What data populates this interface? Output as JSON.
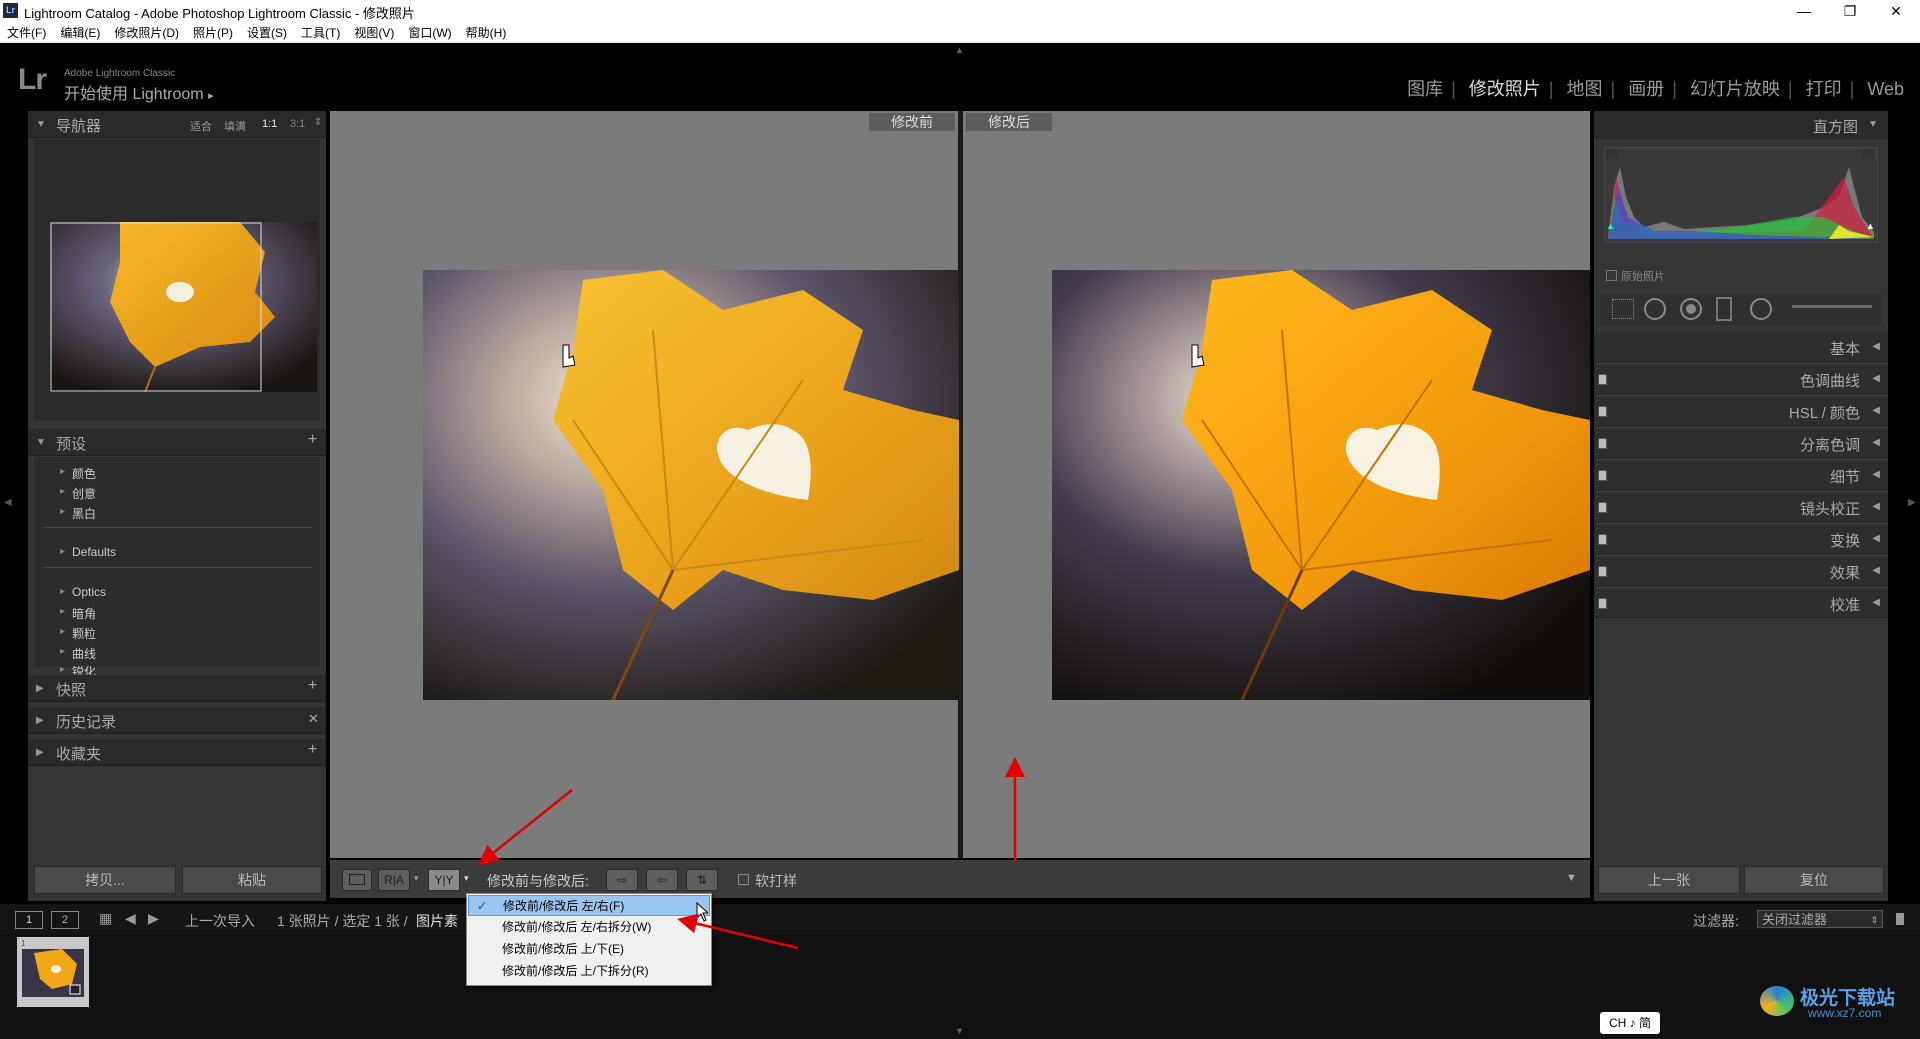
{
  "window": {
    "title": "Lightroom Catalog - Adobe Photoshop Lightroom Classic - 修改照片",
    "app_icon": "Lr",
    "controls": [
      "—",
      "❐",
      "✕"
    ]
  },
  "menu": [
    "文件(F)",
    "编辑(E)",
    "修改照片(D)",
    "照片(P)",
    "设置(S)",
    "工具(T)",
    "视图(V)",
    "窗口(W)",
    "帮助(H)"
  ],
  "identity": {
    "logo": "Lr",
    "small": "Adobe Lightroom Classic",
    "start": "开始使用 Lightroom",
    "start_arrow": "▸"
  },
  "modules": [
    {
      "label": "图库",
      "active": false
    },
    {
      "label": "修改照片",
      "active": true
    },
    {
      "label": "地图",
      "active": false
    },
    {
      "label": "画册",
      "active": false
    },
    {
      "label": "幻灯片放映",
      "active": false
    },
    {
      "label": "打印",
      "active": false
    },
    {
      "label": "Web",
      "active": false
    }
  ],
  "navigator": {
    "title": "导航器",
    "zoom": [
      "适合",
      "填满",
      "1:1",
      "3:1"
    ],
    "zoom_active": "1:1"
  },
  "presets": {
    "title": "预设",
    "add": "+",
    "group1": [
      "颜色",
      "创意",
      "黑白"
    ],
    "group2": [
      "Defaults"
    ],
    "group3": [
      "Optics",
      "暗角",
      "颗粒",
      "曲线",
      "锐化"
    ]
  },
  "left_panels": [
    {
      "title": "快照",
      "action": "+"
    },
    {
      "title": "历史记录",
      "action": "✕"
    },
    {
      "title": "收藏夹",
      "action": "+"
    }
  ],
  "left_buttons": {
    "copy": "拷贝...",
    "paste": "粘贴"
  },
  "view": {
    "before": "修改前",
    "after": "修改后"
  },
  "histogram": {
    "title": "直方图",
    "original": "原始照片"
  },
  "right_panels": [
    "基本",
    "色调曲线",
    "HSL / 颜色",
    "分离色调",
    "细节",
    "镜头校正",
    "变换",
    "效果",
    "校准"
  ],
  "right_buttons": {
    "prev": "上一张",
    "reset": "复位"
  },
  "toolbar": {
    "ra": "R|A",
    "yy": "Y|Y",
    "label": "修改前与修改后:",
    "softproof": "软打样"
  },
  "dropdown": {
    "items": [
      {
        "label": "修改前/修改后 左/右(F)",
        "checked": true
      },
      {
        "label": "修改前/修改后 左/右拆分(W)",
        "checked": false
      },
      {
        "label": "修改前/修改后 上/下(E)",
        "checked": false
      },
      {
        "label": "修改前/修改后 上/下拆分(R)",
        "checked": false
      }
    ],
    "check": "✓"
  },
  "filmstrip": {
    "page1": "1",
    "page2": "2",
    "source": "上一次导入",
    "info": "1 张照片 / 选定 1 张 /",
    "file": "图片素",
    "filter_label": "过滤器:",
    "filter_value": "关闭过滤器",
    "thumb_index": "1"
  },
  "ime": "CH ♪ 简",
  "watermark": {
    "name": "极光下载站",
    "url": "www.xz7.com"
  }
}
